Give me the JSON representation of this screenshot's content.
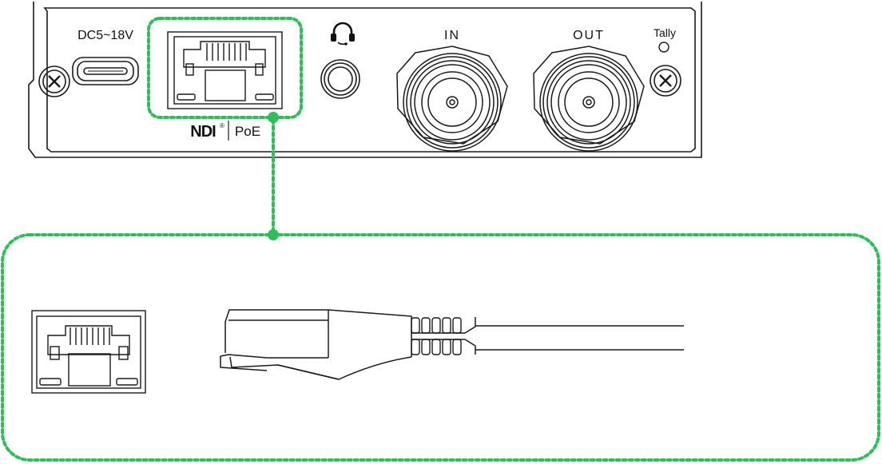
{
  "panel": {
    "power_label": "DC5~18V",
    "input_label": "IN",
    "output_label": "OUT",
    "tally_label": "Tally",
    "ndi_label": "NDI",
    "registered_mark": "®",
    "poe_label": "PoE",
    "headphone_icon": "headphone-icon"
  },
  "detail": {
    "port_icon": "ethernet-port-icon",
    "connector_icon": "rj45-connector-icon"
  },
  "colors": {
    "highlight": "#2dbf5a",
    "line": "#1a1a1a"
  }
}
